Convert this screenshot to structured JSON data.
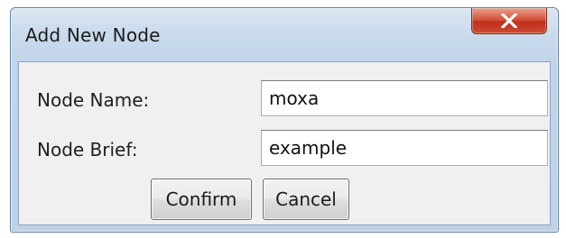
{
  "window": {
    "title": "Add New Node",
    "close_icon": "close-x-icon",
    "colors": {
      "title_bar": "#c9daec",
      "close_button": "#c0301a",
      "client_area": "#f0f0f0"
    }
  },
  "form": {
    "node_name": {
      "label": "Node Name:",
      "value": "moxa"
    },
    "node_brief": {
      "label": "Node Brief:",
      "value": "example"
    }
  },
  "buttons": {
    "confirm_label": "Confirm",
    "cancel_label": "Cancel"
  }
}
